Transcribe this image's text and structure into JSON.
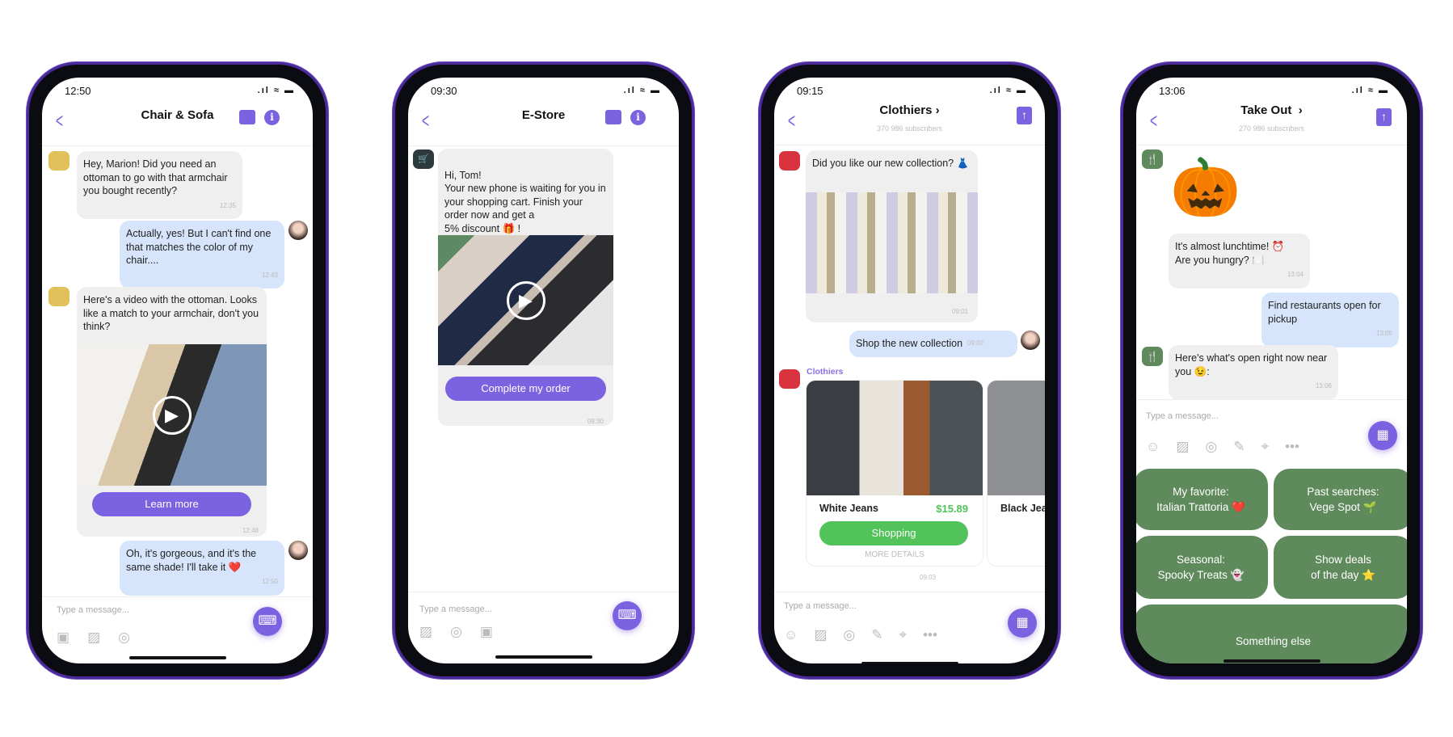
{
  "colors": {
    "accent": "#7b62e0",
    "outgoing": "#d6e5fb",
    "incoming": "#efefef",
    "shop_green": "#52c35a",
    "keyboard_green": "#5f8a5c"
  },
  "phones": [
    {
      "status_time": "12:50",
      "title": "Chair & Sofa",
      "header_icons": [
        "store-icon",
        "info-icon"
      ],
      "messages": [
        {
          "text": "Hey, Marion! Did you need an ottoman to go with that armchair you bought recently?",
          "time": "12:35"
        },
        {
          "text": "Actually, yes! But I can't find one that matches the color of my chair....",
          "time": "12:43"
        },
        {
          "text": "Here's a video with the ottoman. Looks like a match to your armchair, don't you think?",
          "button": "Learn more",
          "time": "12:48"
        },
        {
          "text": "Oh, it's gorgeous, and it's the same shade! I'll take it ❤️",
          "time": "12:50"
        }
      ],
      "input_placeholder": "Type a message..."
    },
    {
      "status_time": "09:30",
      "title": "E-Store",
      "header_icons": [
        "store-icon",
        "info-icon"
      ],
      "messages": [
        {
          "text": "Hi, Tom!\nYour new phone is waiting for you in your shopping cart. Finish your order now and get a\n5% discount 🎁 !",
          "button": "Complete my order",
          "time": "09:30"
        }
      ],
      "input_placeholder": "Type a message..."
    },
    {
      "status_time": "09:15",
      "title": "Clothiers ›",
      "subscribers": "370 986 subscribers",
      "messages": [
        {
          "text": "Did you like our new collection? 👗",
          "time": "09:01"
        },
        {
          "text": "Shop the new collection",
          "time": "09:02"
        }
      ],
      "sender": "Clothiers",
      "cards": [
        {
          "name": "White Jeans",
          "price": "$15.89",
          "button": "Shopping",
          "details": "MORE DETAILS"
        },
        {
          "name": "Black Jeans"
        }
      ],
      "cards_time": "09:03",
      "input_placeholder": "Type a message..."
    },
    {
      "status_time": "13:06",
      "title": "Take Out  ›",
      "subscribers": "270 986 subscribers",
      "messages": [
        {
          "text": "It's almost lunchtime! ⏰\nAre you hungry? 🍽️",
          "time": "13:04"
        },
        {
          "text": "Find restaurants open for pickup",
          "time": "13:05"
        },
        {
          "text": "Here's what's open right now near you 😉:",
          "time": "13:06"
        }
      ],
      "input_placeholder": "Type a message...",
      "keyboard": [
        "My favorite:\nItalian Trattoria ❤️",
        "Past searches:\nVege Spot 🌱",
        "Seasonal:\nSpooky Treats 👻",
        "Show deals\nof the day ⭐",
        "Something else"
      ]
    }
  ]
}
